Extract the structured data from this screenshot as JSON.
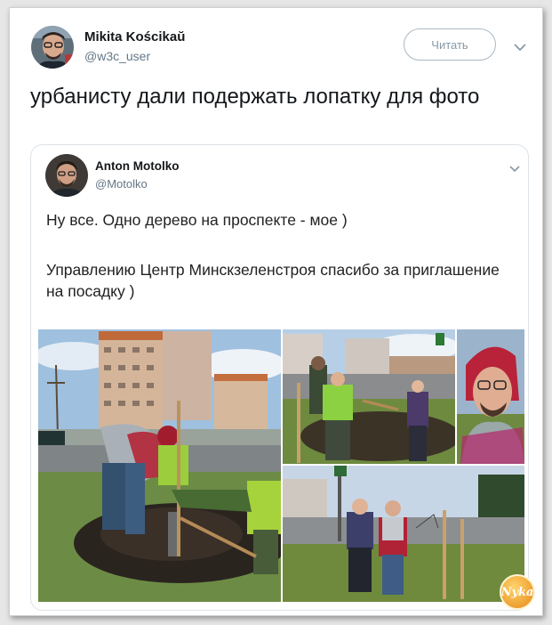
{
  "tweet": {
    "author_name": "Mikita Kościkaŭ",
    "author_handle": "@w3c_user",
    "follow_label": "Читать",
    "text": "урбанисту дали подержать лопатку для фото"
  },
  "quoted": {
    "author_name": "Anton Motolko",
    "author_handle": "@Motolko",
    "line1": "Ну все. Одно дерево на проспекте - мое )",
    "line2": "Управлению Центр Минскзеленстроя спасибо за приглашение на посадку )"
  },
  "watermark": {
    "text": "Nyka"
  },
  "icons": [
    "avatar",
    "chevron-down-icon",
    "photo"
  ],
  "colors": {
    "follow_border": "#aab8c2",
    "handle": "#657786",
    "text": "#14171a"
  }
}
